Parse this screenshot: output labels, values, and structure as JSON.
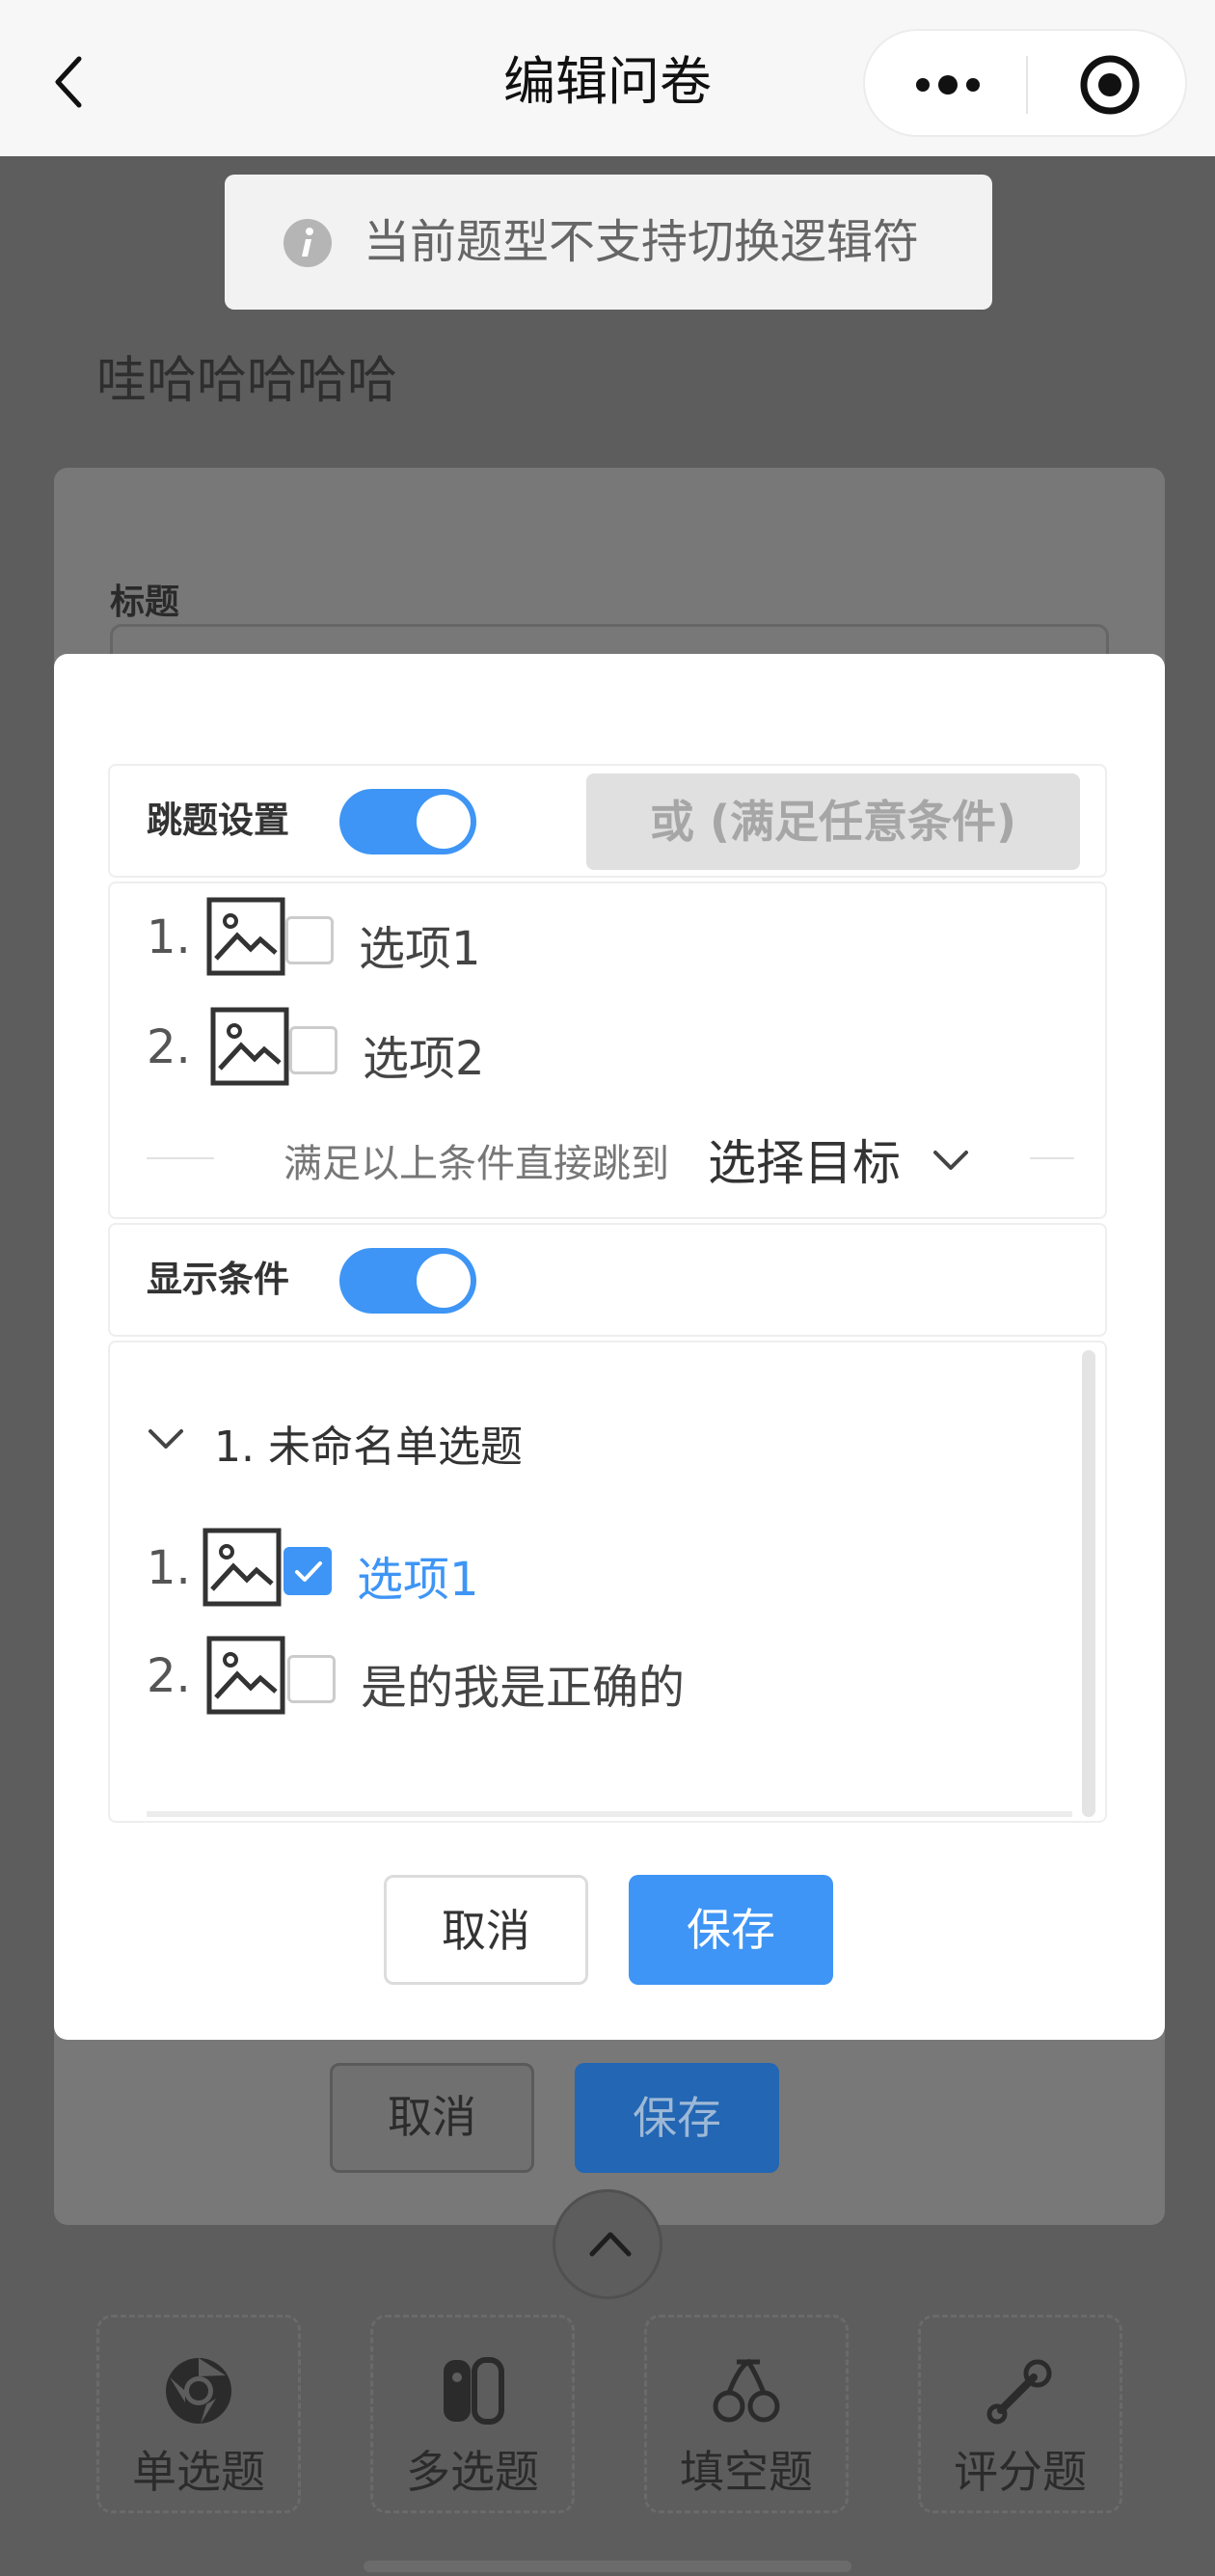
{
  "navbar": {
    "title": "编辑问卷",
    "icons": {
      "back": "chevron-left-icon",
      "more": "more-dots-icon",
      "close": "target-circle-icon"
    }
  },
  "toast": {
    "icon": "info-icon",
    "text": "当前题型不支持切换逻辑符"
  },
  "background": {
    "question_text": "哇哈哈哈哈哈",
    "card_label": "标题",
    "cancel_label": "取消",
    "save_label": "保存",
    "question_types": [
      {
        "label": "单选题",
        "icon": "chrome-icon"
      },
      {
        "label": "多选题",
        "icon": "switch-icon"
      },
      {
        "label": "填空题",
        "icon": "cherry-icon"
      },
      {
        "label": "评分题",
        "icon": "bone-icon"
      }
    ]
  },
  "modal": {
    "jump_settings": {
      "label": "跳题设置",
      "enabled": true,
      "logic_button": "或 (满足任意条件)",
      "options": [
        {
          "num": "1.",
          "text": "选项1",
          "checked": false
        },
        {
          "num": "2.",
          "text": "选项2",
          "checked": false
        }
      ],
      "jump_hint": "满足以上条件直接跳到",
      "jump_target": "选择目标"
    },
    "display_conditions": {
      "label": "显示条件",
      "enabled": true,
      "question": "1. 未命名单选题",
      "options": [
        {
          "num": "1.",
          "text": "选项1",
          "checked": true
        },
        {
          "num": "2.",
          "text": "是的我是正确的",
          "checked": false
        }
      ]
    },
    "buttons": {
      "cancel": "取消",
      "save": "保存"
    }
  },
  "colors": {
    "accent": "#3e95f5",
    "overlay": "#5d5d5d",
    "toggle_on": "#3e95f5"
  }
}
